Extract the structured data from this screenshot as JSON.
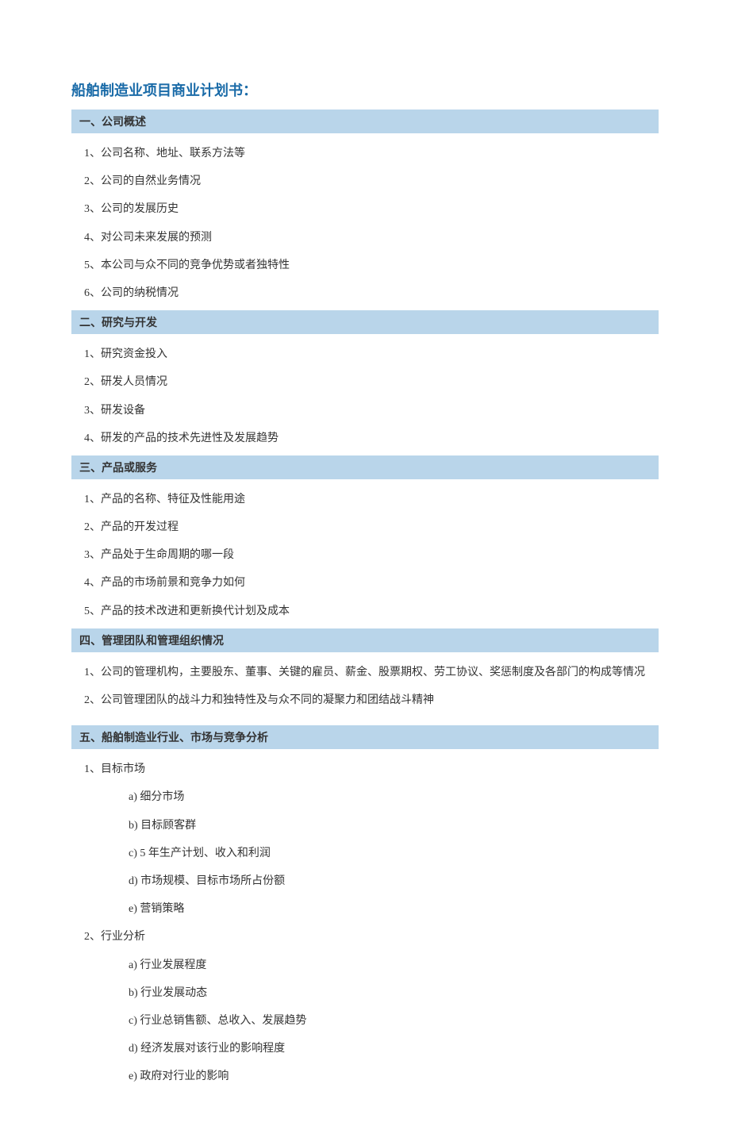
{
  "title": "船舶制造业项目商业计划书：",
  "sections": [
    {
      "header": "一、公司概述",
      "items": [
        "1、公司名称、地址、联系方法等",
        "2、公司的自然业务情况",
        "3、公司的发展历史",
        "4、对公司未来发展的预测",
        "5、本公司与众不同的竞争优势或者独特性",
        "6、公司的纳税情况"
      ]
    },
    {
      "header": "二、研究与开发",
      "items": [
        "1、研究资金投入",
        "2、研发人员情况",
        "3、研发设备",
        "4、研发的产品的技术先进性及发展趋势"
      ]
    },
    {
      "header": "三、产品或服务",
      "items": [
        "1、产品的名称、特征及性能用途",
        "2、产品的开发过程",
        "3、产品处于生命周期的哪一段",
        "4、产品的市场前景和竞争力如何",
        "5、产品的技术改进和更新换代计划及成本"
      ]
    },
    {
      "header": "四、管理团队和管理组织情况",
      "items": [
        "1、公司的管理机构，主要股东、董事、关键的雇员、薪金、股票期权、劳工协议、奖惩制度及各部门的构成等情况",
        "2、公司管理团队的战斗力和独特性及与众不同的凝聚力和团结战斗精神"
      ]
    }
  ],
  "section5": {
    "header": "五、船舶制造业行业、市场与竞争分析",
    "groups": [
      {
        "label": "1、目标市场",
        "subitems": [
          "a)  细分市场",
          "b)  目标顾客群",
          "c) 5 年生产计划、收入和利润",
          "d)  市场规模、目标市场所占份额",
          "e)  营销策略"
        ]
      },
      {
        "label": "2、行业分析",
        "subitems": [
          "a)  行业发展程度",
          "b)  行业发展动态",
          "c)  行业总销售额、总收入、发展趋势",
          "d)  经济发展对该行业的影响程度",
          "e)  政府对行业的影响"
        ]
      }
    ]
  }
}
